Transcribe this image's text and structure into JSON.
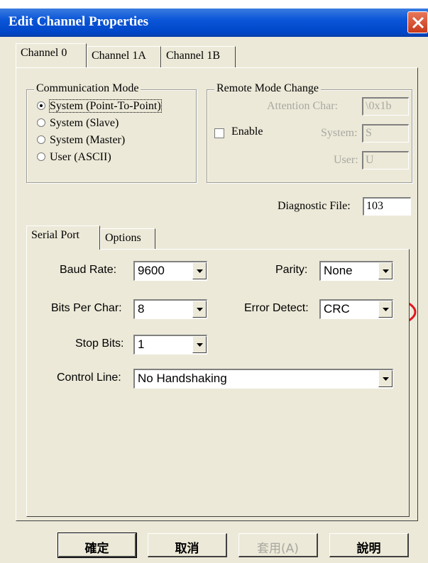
{
  "window": {
    "title": "Edit Channel Properties"
  },
  "channel_tabs": [
    {
      "label": "Channel 0",
      "active": true
    },
    {
      "label": "Channel 1A",
      "active": false
    },
    {
      "label": "Channel 1B",
      "active": false
    }
  ],
  "communication_mode": {
    "label": "Communication Mode",
    "options": [
      {
        "label": "System (Point-To-Point)",
        "selected": true
      },
      {
        "label": "System (Slave)",
        "selected": false
      },
      {
        "label": "System (Master)",
        "selected": false
      },
      {
        "label": "User (ASCII)",
        "selected": false
      }
    ]
  },
  "remote_mode_change": {
    "label": "Remote Mode Change",
    "enable_label": "Enable",
    "enable_checked": false,
    "attention_char": {
      "label": "Attention Char:",
      "value": "\\0x1b"
    },
    "system": {
      "label": "System:",
      "value": "S"
    },
    "user": {
      "label": "User:",
      "value": "U"
    }
  },
  "diagnostic_file": {
    "label": "Diagnostic File:",
    "value": "103"
  },
  "port_tabs": [
    {
      "label": "Serial Port",
      "active": true
    },
    {
      "label": "Options",
      "active": false
    }
  ],
  "serial_port": {
    "baud_rate": {
      "label": "Baud Rate:",
      "value": "9600"
    },
    "parity": {
      "label": "Parity:",
      "value": "None"
    },
    "bits_per_char": {
      "label": "Bits Per Char:",
      "value": "8"
    },
    "error_detect": {
      "label": "Error Detect:",
      "value": "CRC"
    },
    "stop_bits": {
      "label": "Stop Bits:",
      "value": "1"
    },
    "control_line": {
      "label": "Control Line:",
      "value": "No Handshaking"
    }
  },
  "annotation": {
    "highlight_color": "#e0141e"
  },
  "buttons": {
    "ok": "確定",
    "cancel": "取消",
    "apply": "套用(A)",
    "help": "說明"
  }
}
